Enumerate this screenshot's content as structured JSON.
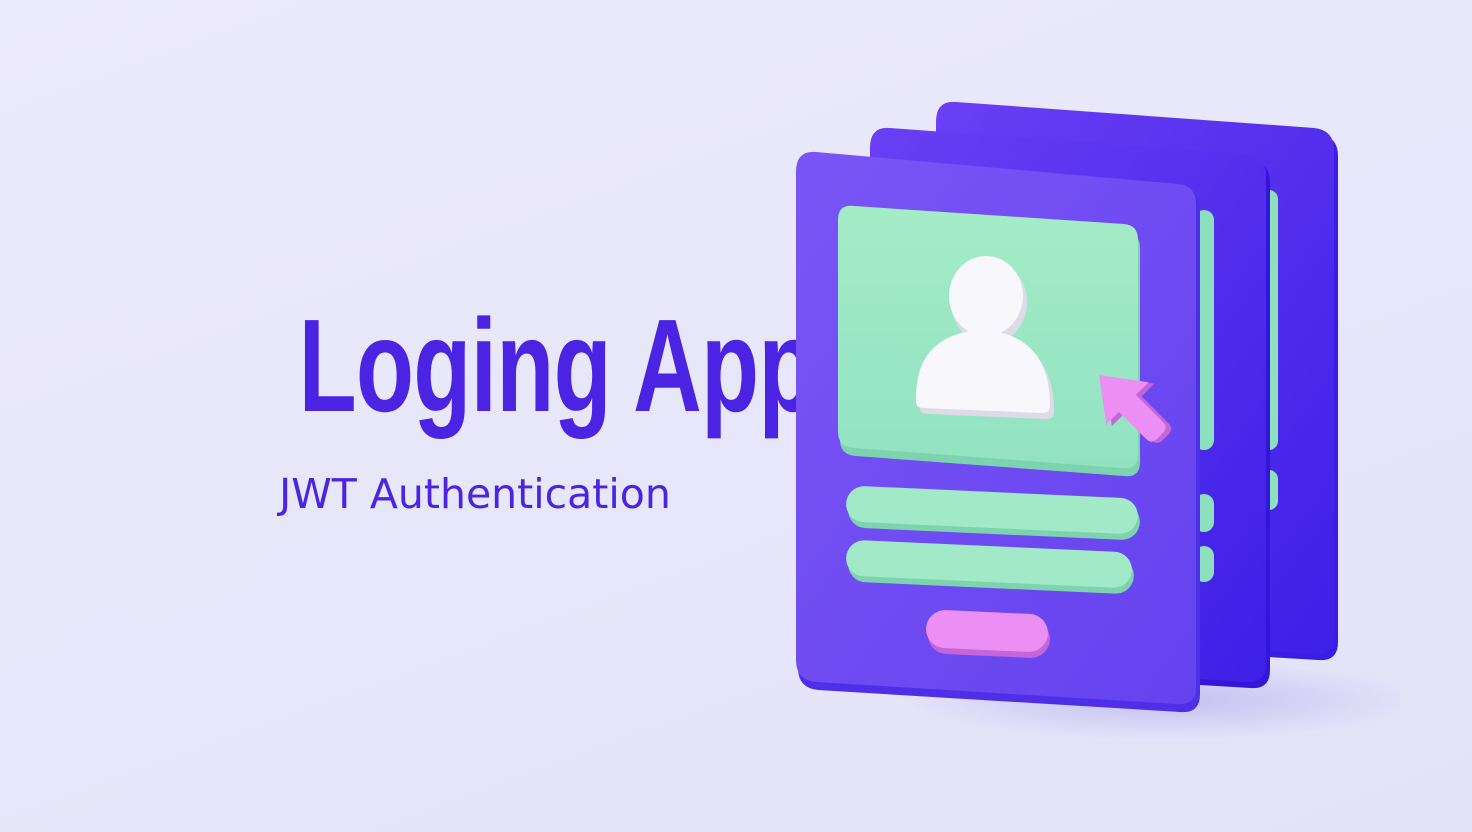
{
  "heading": {
    "title": "Loging App",
    "subtitle": "JWT Authentication"
  },
  "illustration": {
    "icons": [
      "user-avatar-icon",
      "cursor-arrow-icon"
    ],
    "colors": {
      "card": "#6a45f0",
      "card_back": "#4c2cf0",
      "panel": "#9ee8c4",
      "avatar": "#f8f7fb",
      "accent": "#e88af2",
      "text": "#4a24e2"
    }
  }
}
